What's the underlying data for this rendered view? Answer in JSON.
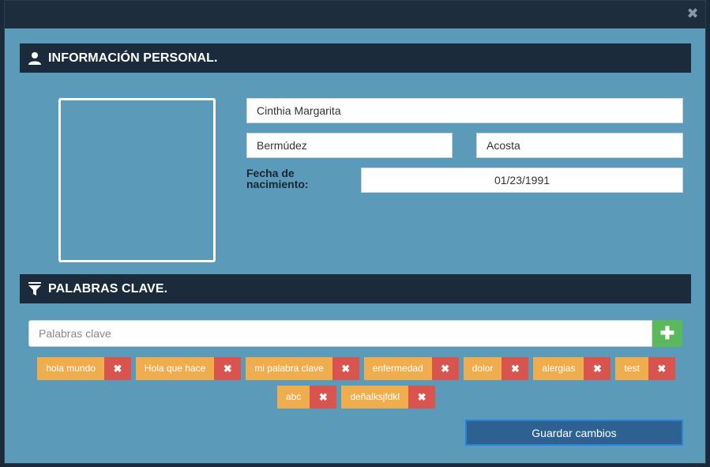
{
  "modal": {
    "close_icon": "close-icon"
  },
  "personal": {
    "title": "INFORMACIÓN PERSONAL.",
    "icon": "user-icon",
    "first_name": "Cinthia Margarita",
    "last_name_1": "Bermúdez",
    "last_name_2": "Acosta",
    "dob_label": "Fecha de nacimiento:",
    "dob_value": "01/23/1991"
  },
  "keywords": {
    "title": "PALABRAS CLAVE.",
    "icon": "filter-icon",
    "placeholder": "Palabras clave",
    "add_icon": "plus-icon",
    "tags_row1": [
      "hola mundo",
      "Hola que hace",
      "mi palabra clave",
      "enfermedad",
      "dolor",
      "alergias",
      "test"
    ],
    "tags_row2": [
      "abc",
      "deñalksjfdkl"
    ],
    "remove_icon": "x-icon"
  },
  "actions": {
    "save_label": "Guardar cambios"
  },
  "colors": {
    "modal_bg": "#5c9ab9",
    "header_bg": "#1b2b3b",
    "tag_bg": "#f0ad4e",
    "tag_remove_bg": "#d9534f",
    "add_bg": "#5cb85c",
    "save_bg": "#2d6192"
  }
}
